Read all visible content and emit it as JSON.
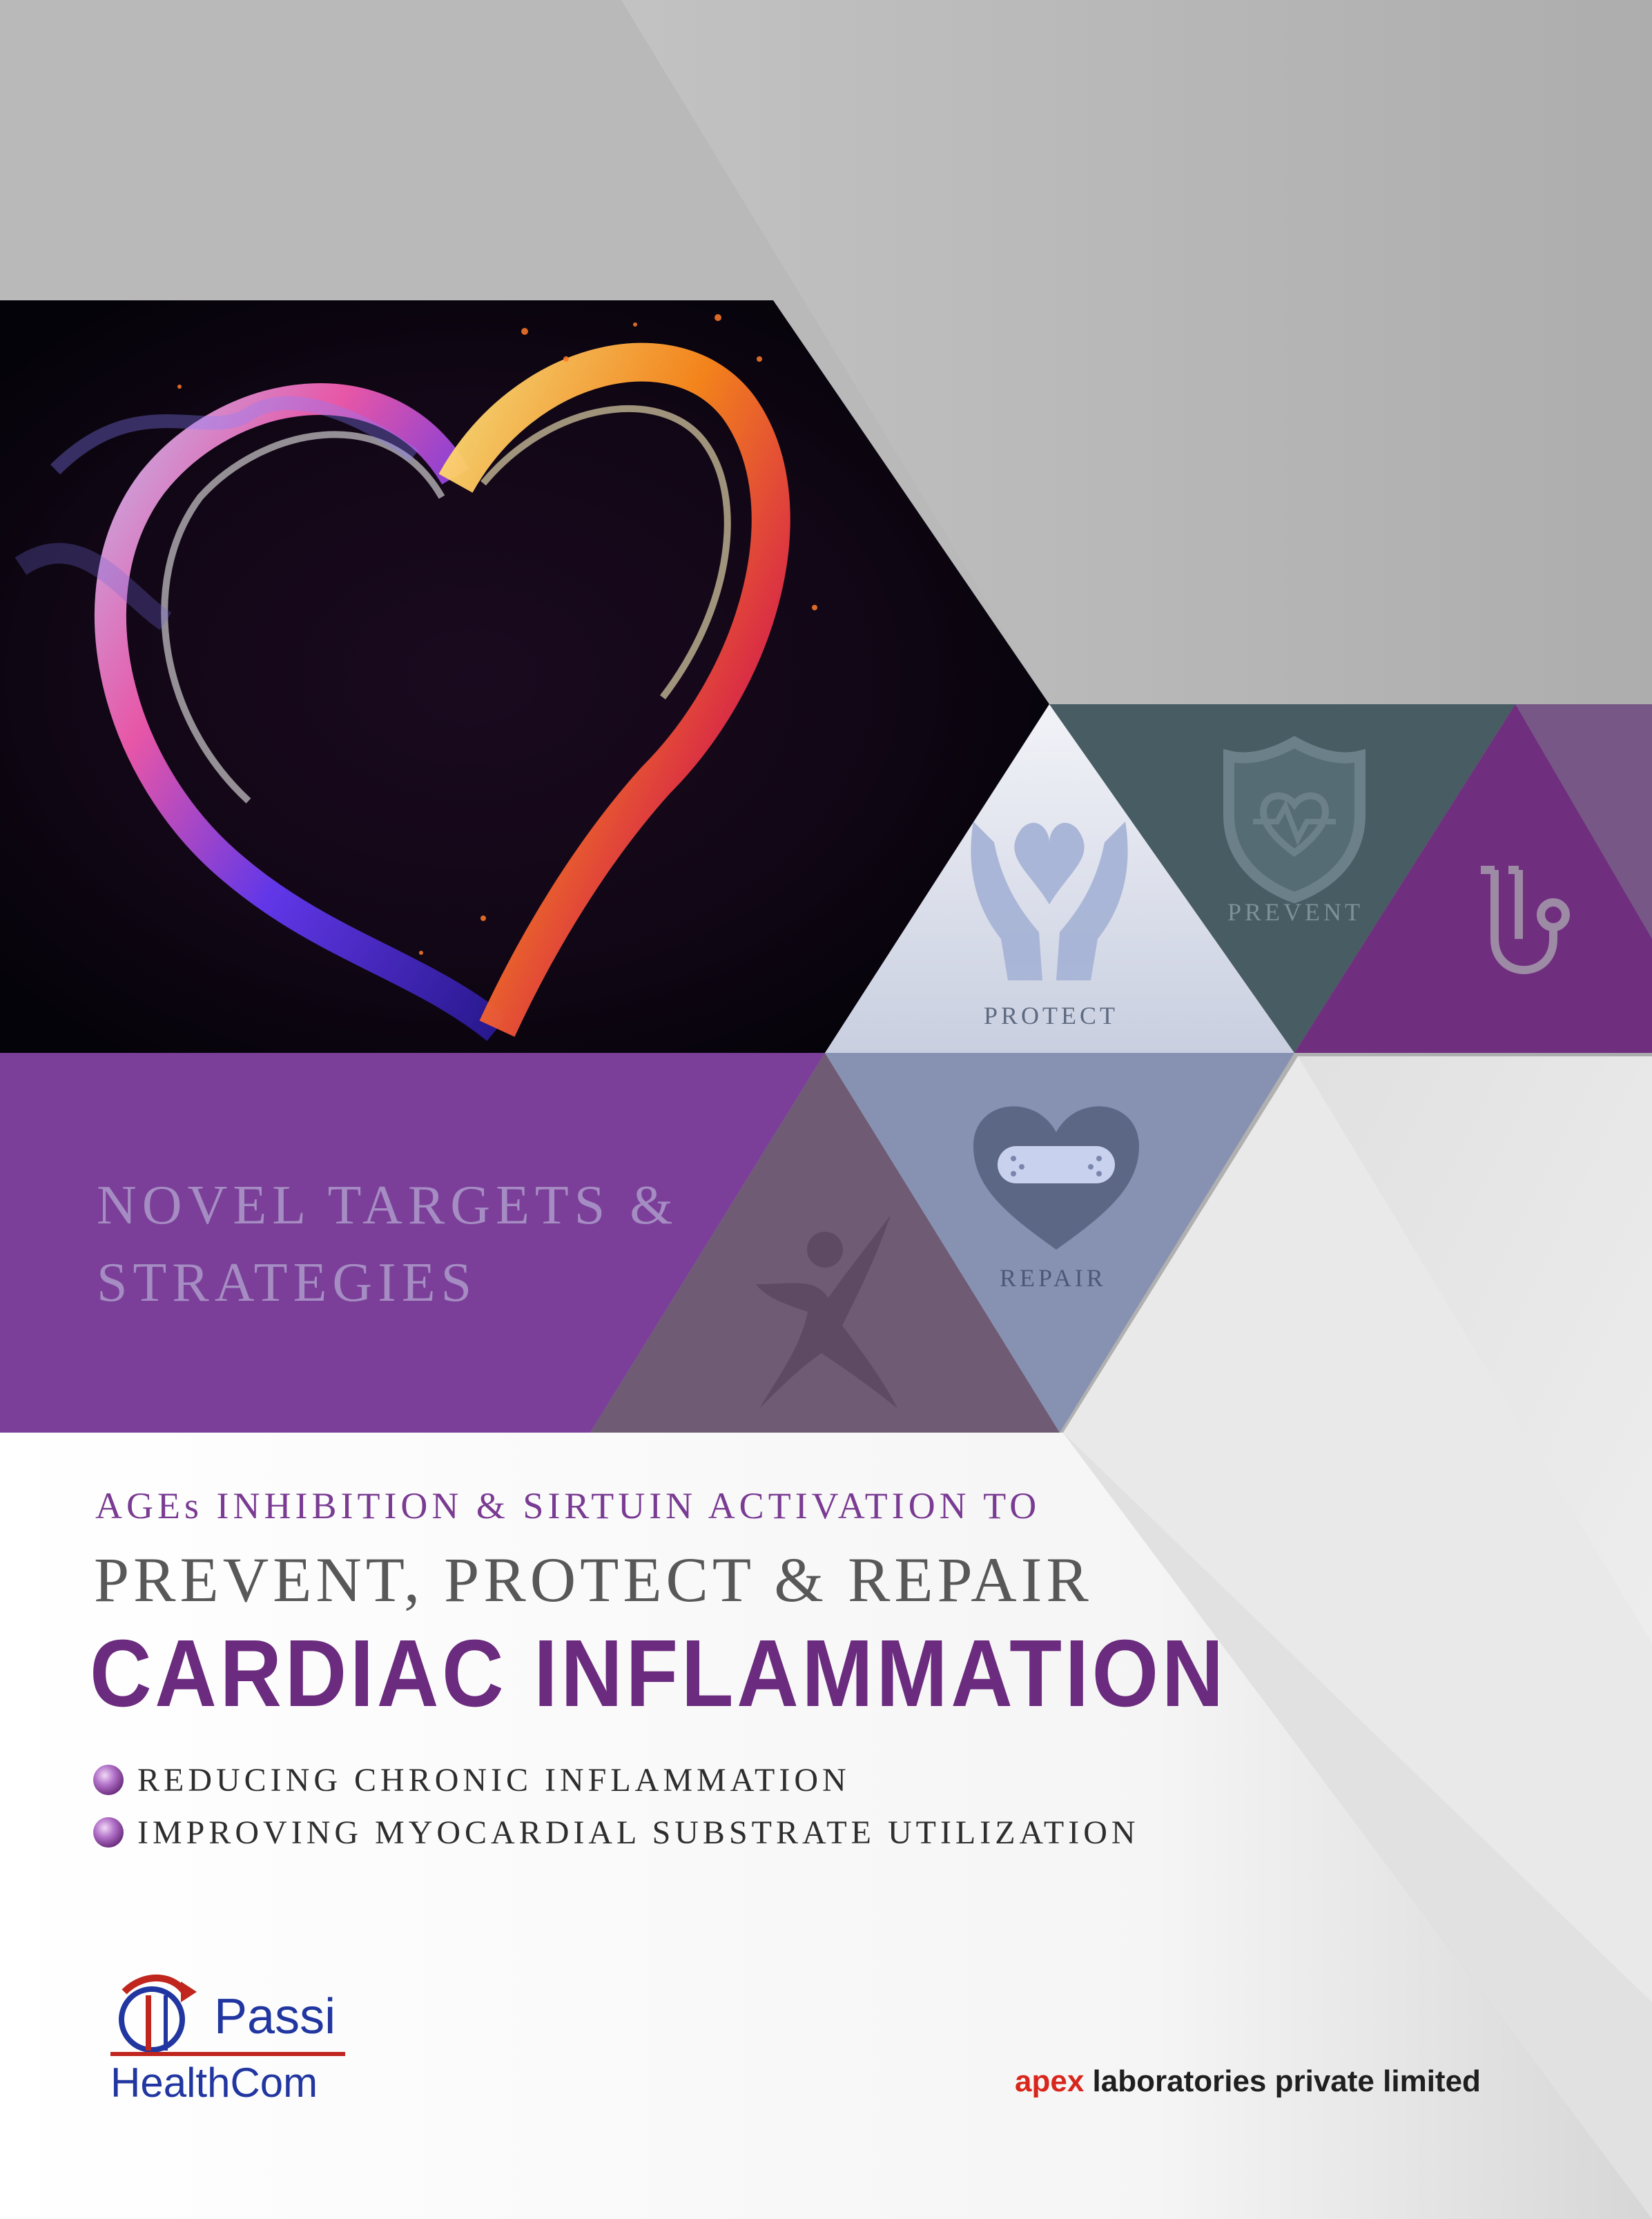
{
  "banner": {
    "line1": "NOVEL TARGETS &",
    "line2": "STRATEGIES"
  },
  "triangles": {
    "protect": "PROTECT",
    "prevent": "PREVENT",
    "repair": "REPAIR"
  },
  "headline": {
    "subheading": "AGEs INHIBITION & SIRTUIN ACTIVATION TO",
    "main": "PREVENT, PROTECT & REPAIR",
    "title": "CARDIAC INFLAMMATION"
  },
  "bullets": [
    "REDUCING CHRONIC INFLAMMATION",
    "IMPROVING MYOCARDIAL SUBSTRATE UTILIZATION"
  ],
  "logos": {
    "passi": "Passi",
    "healthcom": "HealthCom",
    "apex_brand": "apex",
    "apex_rest": " laboratories private limited"
  },
  "icons": [
    "heart-flame-image",
    "hands-heart-icon",
    "shield-heart-icon",
    "stethoscope-icon",
    "bandaged-heart-icon",
    "person-figure-icon",
    "passi-logo-icon"
  ],
  "colors": {
    "purple": "#7b3f99",
    "dark_purple": "#6b2b7e",
    "teal": "#485c63",
    "slate_blue": "#8792b3",
    "grey": "#b3b3b3",
    "apex_red": "#d9261c",
    "passi_blue": "#2136a0"
  }
}
